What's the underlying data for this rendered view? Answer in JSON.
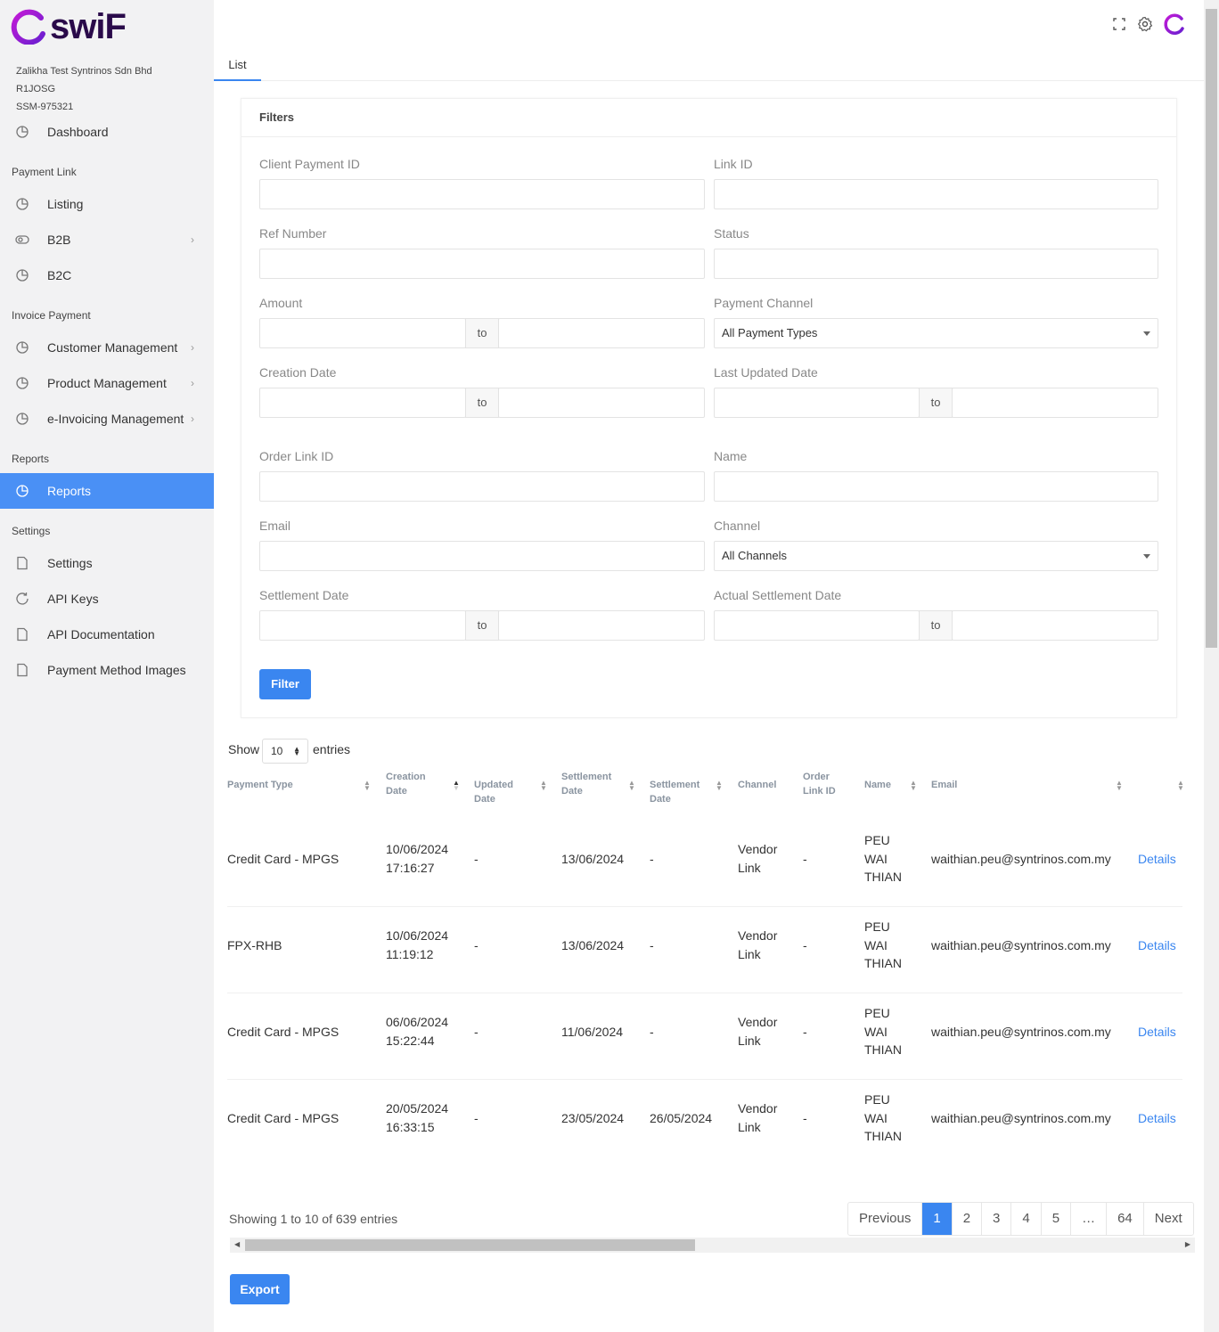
{
  "brand": {
    "name": "swiF"
  },
  "company": {
    "name": "Zalikha Test Syntrinos Sdn Bhd",
    "code": "R1JOSG",
    "ssm": "SSM-975321"
  },
  "sidebar": {
    "dashboard": "Dashboard",
    "sections": {
      "payment_link": "Payment Link",
      "invoice_payment": "Invoice Payment",
      "reports": "Reports",
      "settings": "Settings"
    },
    "items": {
      "listing": "Listing",
      "b2b": "B2B",
      "b2c": "B2C",
      "customer_management": "Customer Management",
      "product_management": "Product Management",
      "einvoicing_management": "e-Invoicing Management",
      "reports": "Reports",
      "settings": "Settings",
      "api_keys": "API Keys",
      "api_documentation": "API Documentation",
      "payment_method_images": "Payment Method Images"
    }
  },
  "tab": {
    "label": "List"
  },
  "filters": {
    "title": "Filters",
    "client_payment_id": "Client Payment ID",
    "link_id": "Link ID",
    "ref_number": "Ref Number",
    "status": "Status",
    "amount": "Amount",
    "payment_channel": "Payment Channel",
    "payment_channel_value": "All Payment Types",
    "creation_date": "Creation Date",
    "last_updated_date": "Last Updated Date",
    "order_link_id": "Order Link ID",
    "name": "Name",
    "email": "Email",
    "channel": "Channel",
    "channel_value": "All Channels",
    "settlement_date": "Settlement Date",
    "actual_settlement_date": "Actual Settlement Date",
    "to": "to",
    "filter_button": "Filter"
  },
  "table_controls": {
    "show": "Show",
    "page_size": "10",
    "entries": "entries"
  },
  "table": {
    "headers": {
      "payment_type": "Payment Type",
      "creation_date": [
        "Creation",
        "Date"
      ],
      "updated_date": [
        "Updated",
        "Date"
      ],
      "settlement_date": [
        "Settlement",
        "Date"
      ],
      "settlement_date2": [
        "Settlement",
        "Date"
      ],
      "channel": "Channel",
      "order_link_id": [
        "Order",
        "Link ID"
      ],
      "name": "Name",
      "email": "Email"
    },
    "rows": [
      {
        "payment_type": "Credit Card - MPGS",
        "created": [
          "10/06/2024",
          "17:16:27"
        ],
        "updated": "-",
        "settlement": "13/06/2024",
        "actual_settlement": "-",
        "channel": [
          "Vendor",
          "Link"
        ],
        "order_link": "-",
        "name": [
          "PEU",
          "WAI",
          "THIAN"
        ],
        "email": "waithian.peu@syntrinos.com.my",
        "action": "Details"
      },
      {
        "payment_type": "FPX-RHB",
        "created": [
          "10/06/2024",
          "11:19:12"
        ],
        "updated": "-",
        "settlement": "13/06/2024",
        "actual_settlement": "-",
        "channel": [
          "Vendor",
          "Link"
        ],
        "order_link": "-",
        "name": [
          "PEU",
          "WAI",
          "THIAN"
        ],
        "email": "waithian.peu@syntrinos.com.my",
        "action": "Details"
      },
      {
        "payment_type": "Credit Card - MPGS",
        "created": [
          "06/06/2024",
          "15:22:44"
        ],
        "updated": "-",
        "settlement": "11/06/2024",
        "actual_settlement": "-",
        "channel": [
          "Vendor",
          "Link"
        ],
        "order_link": "-",
        "name": [
          "PEU",
          "WAI",
          "THIAN"
        ],
        "email": "waithian.peu@syntrinos.com.my",
        "action": "Details"
      },
      {
        "payment_type": "Credit Card - MPGS",
        "created": [
          "20/05/2024",
          "16:33:15"
        ],
        "updated": "-",
        "settlement": "23/05/2024",
        "actual_settlement": "26/05/2024",
        "channel": [
          "Vendor",
          "Link"
        ],
        "order_link": "-",
        "name": [
          "PEU",
          "WAI",
          "THIAN"
        ],
        "email": "waithian.peu@syntrinos.com.my",
        "action": "Details"
      }
    ]
  },
  "footer": {
    "showing": "Showing 1 to 10 of 639 entries",
    "pagination": [
      "Previous",
      "1",
      "2",
      "3",
      "4",
      "5",
      "…",
      "64",
      "Next"
    ],
    "current_page": "1",
    "export": "Export"
  },
  "colors": {
    "primary": "#3a86f0",
    "brand_magenta": "#c21ad6",
    "brand_purple": "#6a1fd0",
    "sidebar_bg": "#f2f2f3"
  }
}
